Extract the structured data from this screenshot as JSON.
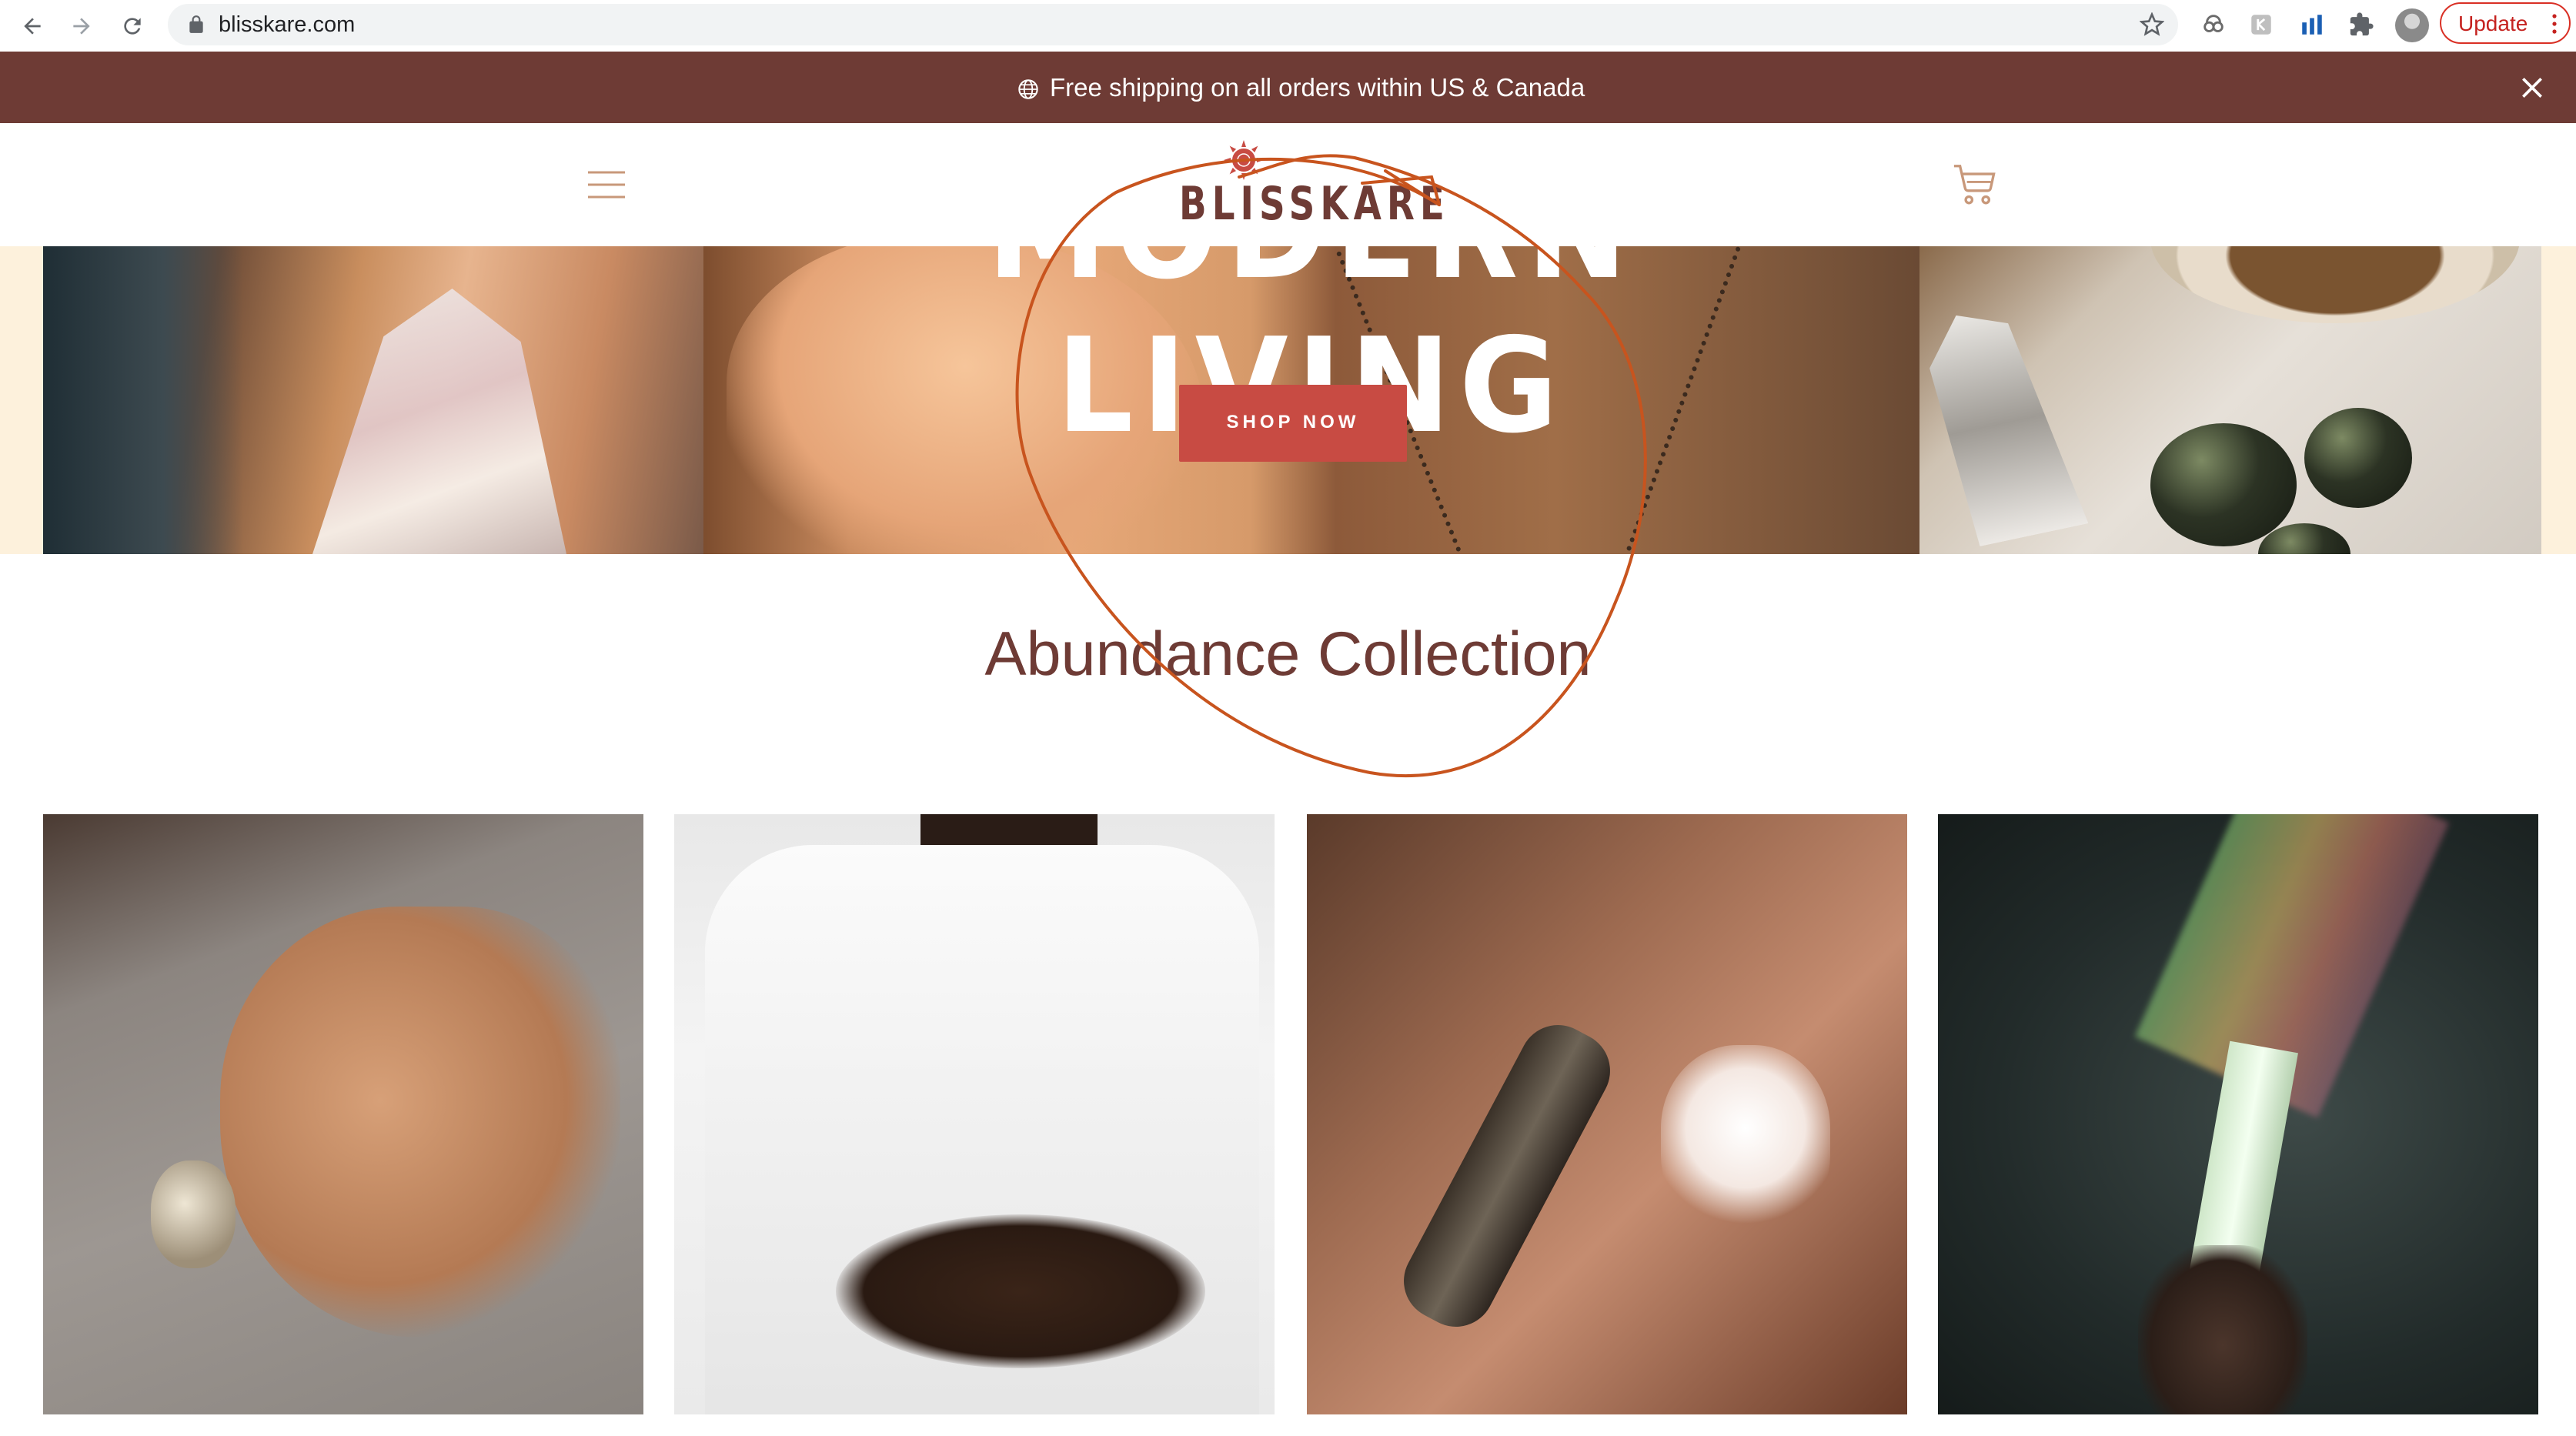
{
  "browser": {
    "url": "blisskare.com",
    "update_label": "Update",
    "icons": [
      "back-icon",
      "forward-icon",
      "reload-icon",
      "lock-icon",
      "star-icon",
      "extension-icons",
      "puzzle-icon",
      "profile-avatar",
      "more-icon"
    ]
  },
  "announcement": {
    "text": "Free shipping on all orders within US & Canada",
    "icon": "globe-icon",
    "close_icon": "close-icon"
  },
  "header": {
    "logo_text": "BLISSKARE",
    "menu_icon": "hamburger-icon",
    "cart_icon": "cart-icon"
  },
  "hero": {
    "headline": "MODERN LIVING",
    "button_label": "SHOP NOW",
    "background_color": "#fdf1dc"
  },
  "collection": {
    "title": "Abundance Collection",
    "cards": [
      {
        "image": "hand-with-ring-and-pendant-necklace"
      },
      {
        "image": "man-in-white-tee-with-necklaces-and-rings"
      },
      {
        "image": "burning-sage-with-salt-lamp"
      },
      {
        "image": "crystal-prism-with-rainbow-beam"
      }
    ]
  },
  "colors": {
    "brand_brown": "#6e3b35",
    "button_red": "#c84b43",
    "icon_tan": "#c8987a",
    "annotation_orange": "#c8541e",
    "update_red": "#d93025"
  }
}
